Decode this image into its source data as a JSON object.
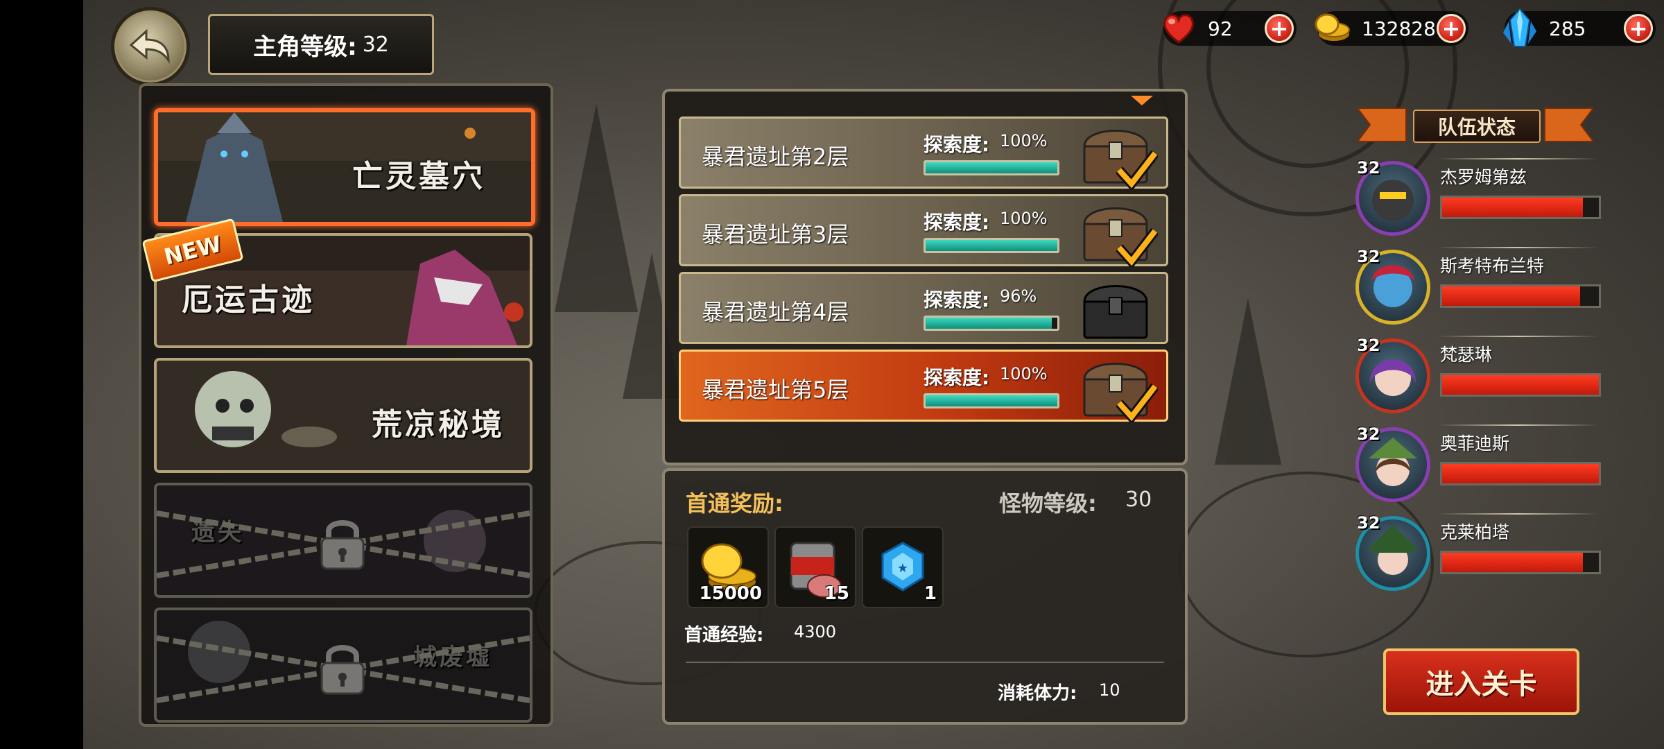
{
  "player": {
    "level_label": "主角等级:",
    "level": "32"
  },
  "resources": {
    "stamina": {
      "icon": "heart-icon",
      "value": "92"
    },
    "gold": {
      "icon": "gold-coin-icon",
      "value": "132828"
    },
    "gems": {
      "icon": "blue-crystal-icon",
      "value": "285"
    }
  },
  "dungeons": [
    {
      "name": "亡灵墓穴",
      "state": "selected",
      "is_new": false
    },
    {
      "name": "厄运古迹",
      "state": "unlocked",
      "is_new": true,
      "badge": "NEW"
    },
    {
      "name": "荒凉秘境",
      "state": "unlocked",
      "is_new": false
    },
    {
      "name": "遗失",
      "state": "locked",
      "is_new": false
    },
    {
      "name": "城废墟",
      "state": "locked",
      "is_new": false
    }
  ],
  "floors": {
    "explore_label": "探索度",
    "items": [
      {
        "name": "暴君遗址第2层",
        "explore": "100%",
        "fill": 1.0,
        "chest_opened": true
      },
      {
        "name": "暴君遗址第3层",
        "explore": "100%",
        "fill": 1.0,
        "chest_opened": true
      },
      {
        "name": "暴君遗址第4层",
        "explore": "96%",
        "fill": 0.96,
        "chest_opened": false
      },
      {
        "name": "暴君遗址第5层",
        "explore": "100%",
        "fill": 1.0,
        "chest_opened": true,
        "selected": true
      }
    ]
  },
  "reward": {
    "title": "首通奖励:",
    "monster_level_label": "怪物等级:",
    "monster_level": "30",
    "items": [
      {
        "icon": "gold-coins-icon",
        "qty": "15000"
      },
      {
        "icon": "meat-can-icon",
        "qty": "15"
      },
      {
        "icon": "blue-gem-icon",
        "qty": "1"
      }
    ],
    "exp_label": "首通经验:",
    "exp_value": "4300",
    "stamina_cost_label": "消耗体力:",
    "stamina_cost_value": "10"
  },
  "team": {
    "title": "队伍状态",
    "members": [
      {
        "level": "32",
        "name": "杰罗姆第兹",
        "hp": 0.9,
        "frame_color": "#8a3fb1"
      },
      {
        "level": "32",
        "name": "斯考特布兰特",
        "hp": 0.88,
        "frame_color": "#d7b22a"
      },
      {
        "level": "32",
        "name": "梵瑟琳",
        "hp": 1.0,
        "frame_color": "#c5341f"
      },
      {
        "level": "32",
        "name": "奥菲迪斯",
        "hp": 1.0,
        "frame_color": "#8a3fb1"
      },
      {
        "level": "32",
        "name": "克莱柏塔",
        "hp": 0.9,
        "frame_color": "#1d8fa8"
      }
    ]
  },
  "enter_button": "进入关卡"
}
